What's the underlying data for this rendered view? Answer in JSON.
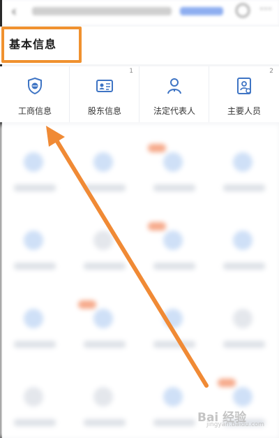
{
  "section": {
    "title": "基本信息"
  },
  "cards": [
    {
      "label": "工商信息",
      "icon": "shield-icon",
      "count": ""
    },
    {
      "label": "股东信息",
      "icon": "id-card-icon",
      "count": "1"
    },
    {
      "label": "法定代表人",
      "icon": "person-icon",
      "count": ""
    },
    {
      "label": "主要人员",
      "icon": "profile-document-icon",
      "count": "2"
    }
  ],
  "watermark": {
    "text": "Bai 经验",
    "sub": "jingyan.baidu.com"
  },
  "colors": {
    "highlight": "#f0912f",
    "icon_blue": "#3e74c4",
    "arrow": "#f08a35"
  }
}
